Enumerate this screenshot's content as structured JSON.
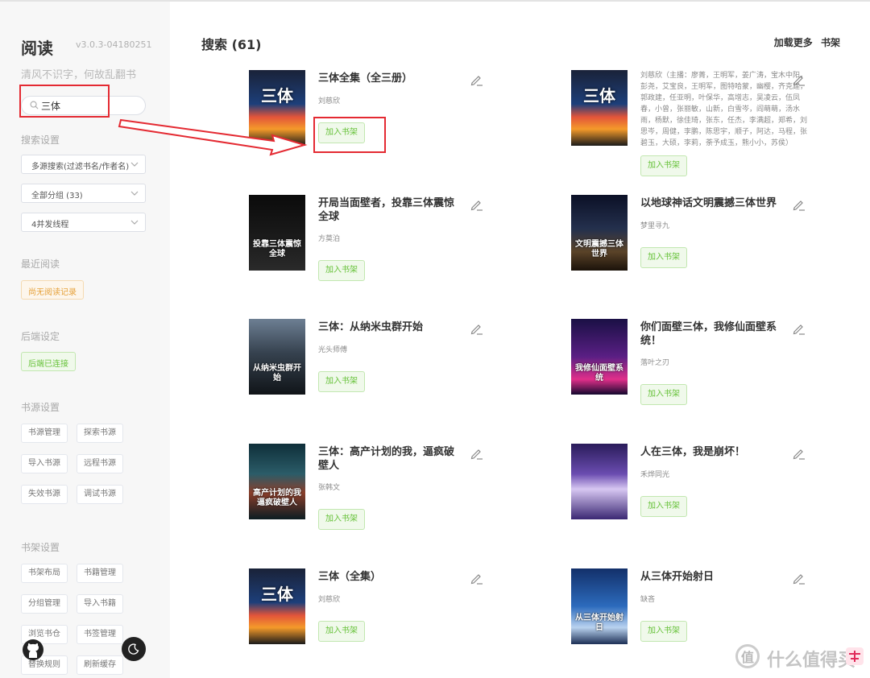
{
  "app": {
    "title": "阅读",
    "version": "v3.0.3-04180251",
    "slogan": "清风不识字，何故乱翻书"
  },
  "search": {
    "value": "三体",
    "placeholder": ""
  },
  "sidebar": {
    "search_settings": {
      "title": "搜索设置",
      "mode": "多源搜索(过滤书名/作者名)",
      "group": "全部分组 (33)",
      "threads": "4并发线程"
    },
    "recent": {
      "title": "最近阅读",
      "empty": "尚无阅读记录"
    },
    "backend": {
      "title": "后端设定",
      "status": "后端已连接"
    },
    "source_settings": {
      "title": "书源设置",
      "buttons": [
        "书源管理",
        "探索书源",
        "导入书源",
        "远程书源",
        "失效书源",
        "调试书源"
      ]
    },
    "shelf_settings": {
      "title": "书架设置",
      "buttons": [
        "书架布局",
        "书籍管理",
        "分组管理",
        "导入书籍",
        "浏览书仓",
        "书签管理",
        "替换规则",
        "刷新缓存"
      ]
    }
  },
  "main": {
    "heading": "搜索 (61)",
    "load_more": "加载更多",
    "shelf": "书架",
    "add_label": "加入书架"
  },
  "books": [
    {
      "title": "三体全集（全三册）",
      "author": "刘慈欣",
      "cover_text": "三体",
      "cover_style": "santi"
    },
    {
      "title": "",
      "author": "刘慈欣（主播：廖菁，王明军，姜广涛，宝木中阳，彭尧，艾宝良，王明军，图特哈蒙，幽樱，齐克建，郭政建，任亚明，叶保华，高增志，吴凌云，伍凤春，小曾，张丽敏，山新，白雪岑，阎萌萌，汤水雨，杨默，徐佳琦，张东，任杰，李满超，郑希，刘思岑，周健，李鹏，陈思宇，顺子，阿达，马程，张碧玉，大硕，李莉，荼予成玉，熊小小，苏侯）",
      "cover_text": "三体",
      "cover_style": "santi"
    },
    {
      "title": "开局当面壁者，投靠三体震惊全球",
      "author": "方莫泊",
      "cover_text": "投靠三体震惊全球",
      "cover_style": "dark"
    },
    {
      "title": "以地球神话文明震撼三体世界",
      "author": "梦里寻九",
      "cover_text": "文明震撼三体世界",
      "cover_style": "planet"
    },
    {
      "title": "三体：从纳米虫群开始",
      "author": "光头师傅",
      "cover_text": "从纳米虫群开始",
      "cover_style": "storm"
    },
    {
      "title": "你们面壁三体，我修仙面壁系统！",
      "author": "落叶之刃",
      "cover_text": "我修仙面壁系统",
      "cover_style": "neon"
    },
    {
      "title": "三体：高产计划的我，逼疯破壁人",
      "author": "张韩文",
      "cover_text": "高产计划的我逼疯破壁人",
      "cover_style": "ocean"
    },
    {
      "title": "人在三体，我是崩坏！",
      "author": "禾烨同光",
      "cover_text": "",
      "cover_style": "anime"
    },
    {
      "title": "三体（全集）",
      "author": "刘慈欣",
      "cover_text": "三体",
      "cover_style": "santi"
    },
    {
      "title": "从三体开始射日",
      "author": "缺吝",
      "cover_text": "从三体开始射日",
      "cover_style": "blue"
    }
  ],
  "watermark": {
    "text": "什么值得买",
    "logo": "值"
  },
  "colors": {
    "accent": "#67c23a",
    "annotation": "#e42a32",
    "sidebar_bg": "#f7f7f7"
  }
}
